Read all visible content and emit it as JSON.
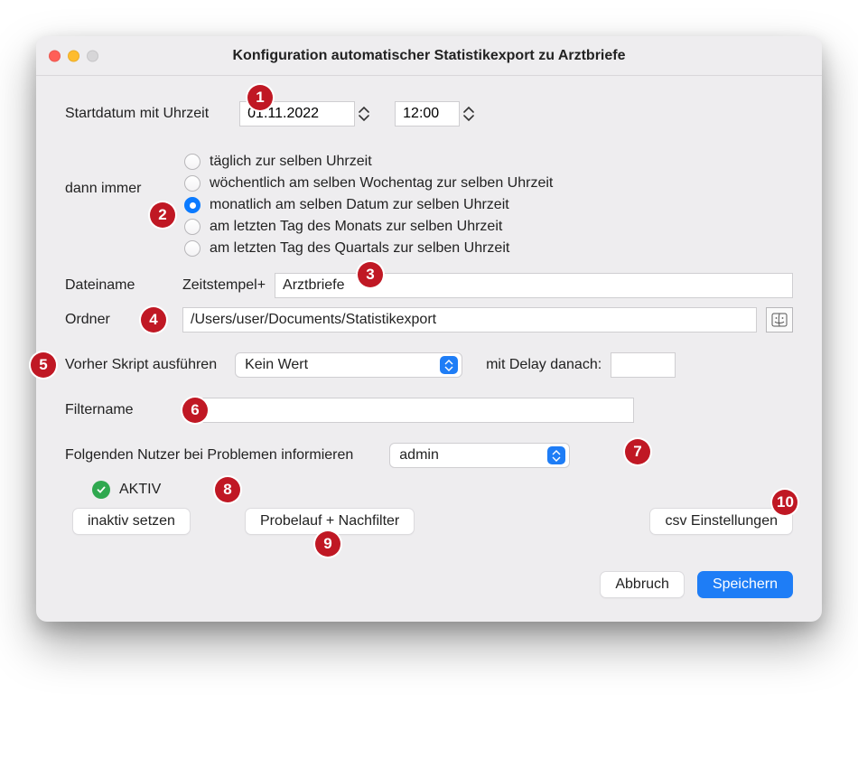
{
  "window": {
    "title": "Konfiguration automatischer Statistikexport zu Arztbriefe"
  },
  "start": {
    "label": "Startdatum mit Uhrzeit",
    "date": "01.11.2022",
    "time": "12:00"
  },
  "interval": {
    "label": "dann immer",
    "options": [
      "täglich zur selben Uhrzeit",
      "wöchentlich am selben Wochentag zur selben Uhrzeit",
      "monatlich am selben Datum zur selben Uhrzeit",
      "am letzten Tag des Monats zur selben Uhrzeit",
      "am letzten Tag des Quartals zur selben Uhrzeit"
    ],
    "selected_index": 2
  },
  "filename": {
    "label": "Dateiname",
    "prefix_label": "Zeitstempel+",
    "value": "Arztbriefe"
  },
  "folder": {
    "label": "Ordner",
    "value": "/Users/user/Documents/Statistikexport"
  },
  "prescript": {
    "label": "Vorher Skript ausführen",
    "value": "Kein Wert",
    "delay_label": "mit Delay danach:",
    "delay_value": ""
  },
  "filter": {
    "label": "Filtername",
    "value": ""
  },
  "notify": {
    "label": "Folgenden Nutzer bei Problemen informieren",
    "value": "admin"
  },
  "status": {
    "text": "AKTIV",
    "toggle_button": "inaktiv setzen"
  },
  "buttons": {
    "probe": "Probelauf + Nachfilter",
    "csv": "csv Einstellungen",
    "cancel": "Abbruch",
    "save": "Speichern"
  },
  "annotations": {
    "1": "1",
    "2": "2",
    "3": "3",
    "4": "4",
    "5": "5",
    "6": "6",
    "7": "7",
    "8": "8",
    "9": "9",
    "10": "10"
  }
}
